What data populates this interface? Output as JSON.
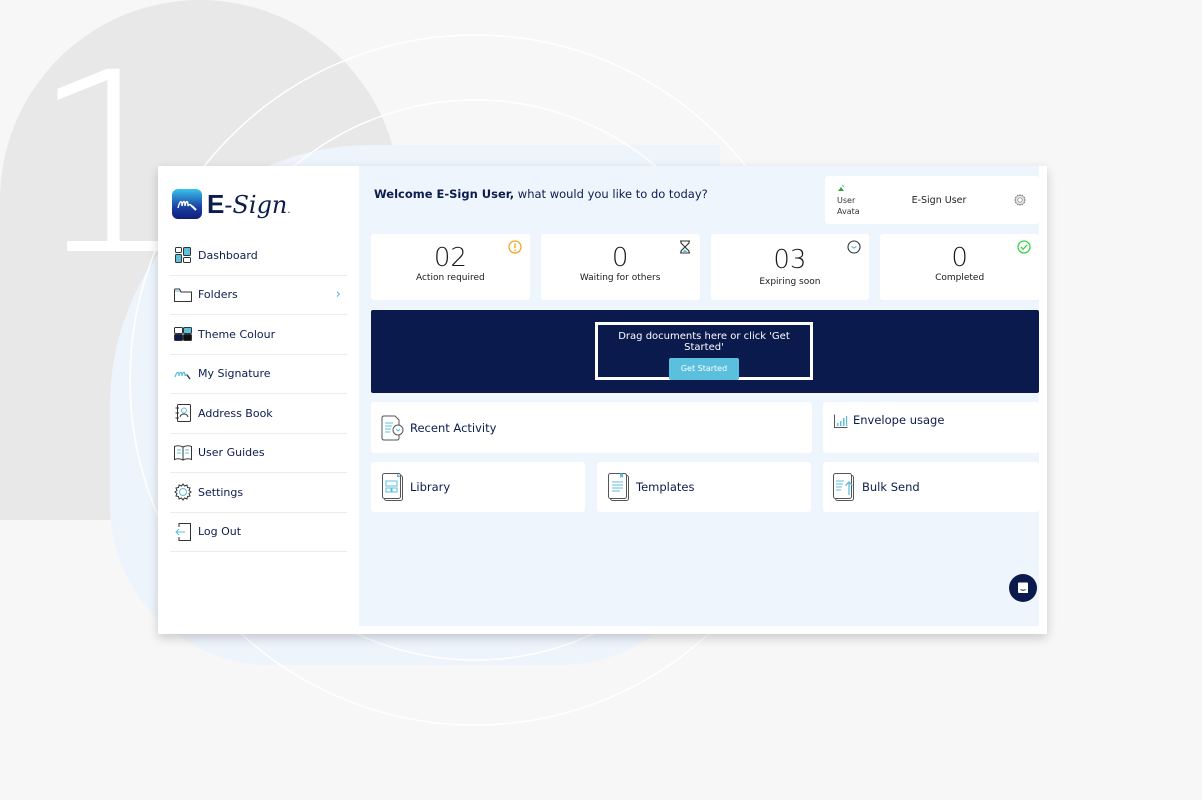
{
  "background": {
    "step_number": "1"
  },
  "brand": {
    "name_bold": "E",
    "name_script": "-Sign",
    "trademark": "."
  },
  "sidebar": {
    "items": [
      {
        "label": "Dashboard",
        "icon": "dashboard-icon"
      },
      {
        "label": "Folders",
        "icon": "folder-icon",
        "has_submenu": true
      },
      {
        "label": "Theme Colour",
        "icon": "theme-colour-icon"
      },
      {
        "label": "My Signature",
        "icon": "signature-icon"
      },
      {
        "label": "Address Book",
        "icon": "address-book-icon"
      },
      {
        "label": "User Guides",
        "icon": "user-guides-icon"
      },
      {
        "label": "Settings",
        "icon": "settings-icon"
      },
      {
        "label": "Log Out",
        "icon": "logout-icon"
      }
    ]
  },
  "header": {
    "welcome_bold": "Welcome E-Sign User,",
    "welcome_rest": " what would you like to do today?"
  },
  "user": {
    "avatar_alt_line1": "User",
    "avatar_alt_line2": "Avata",
    "name": "E-Sign User"
  },
  "stats": [
    {
      "value": "02",
      "label": "Action required",
      "icon": "alert-icon",
      "color": "#f5a623"
    },
    {
      "value": "0",
      "label": "Waiting for others",
      "icon": "hourglass-icon",
      "color": "#333333"
    },
    {
      "value": "03",
      "label": "Expiring soon",
      "icon": "clock-icon",
      "color": "#333333"
    },
    {
      "value": "0",
      "label": "Completed",
      "icon": "check-circle-icon",
      "color": "#3ad34a"
    }
  ],
  "dropzone": {
    "text": "Drag documents here or click 'Get Started'",
    "button_label": "Get Started"
  },
  "tiles": {
    "recent_activity": "Recent Activity",
    "envelope_usage": "Envelope usage",
    "library": "Library",
    "templates": "Templates",
    "bulk_send": "Bulk Send"
  },
  "colors": {
    "navy": "#0a1a4c",
    "accent": "#5bbfde",
    "main_bg": "#eff5fd"
  }
}
